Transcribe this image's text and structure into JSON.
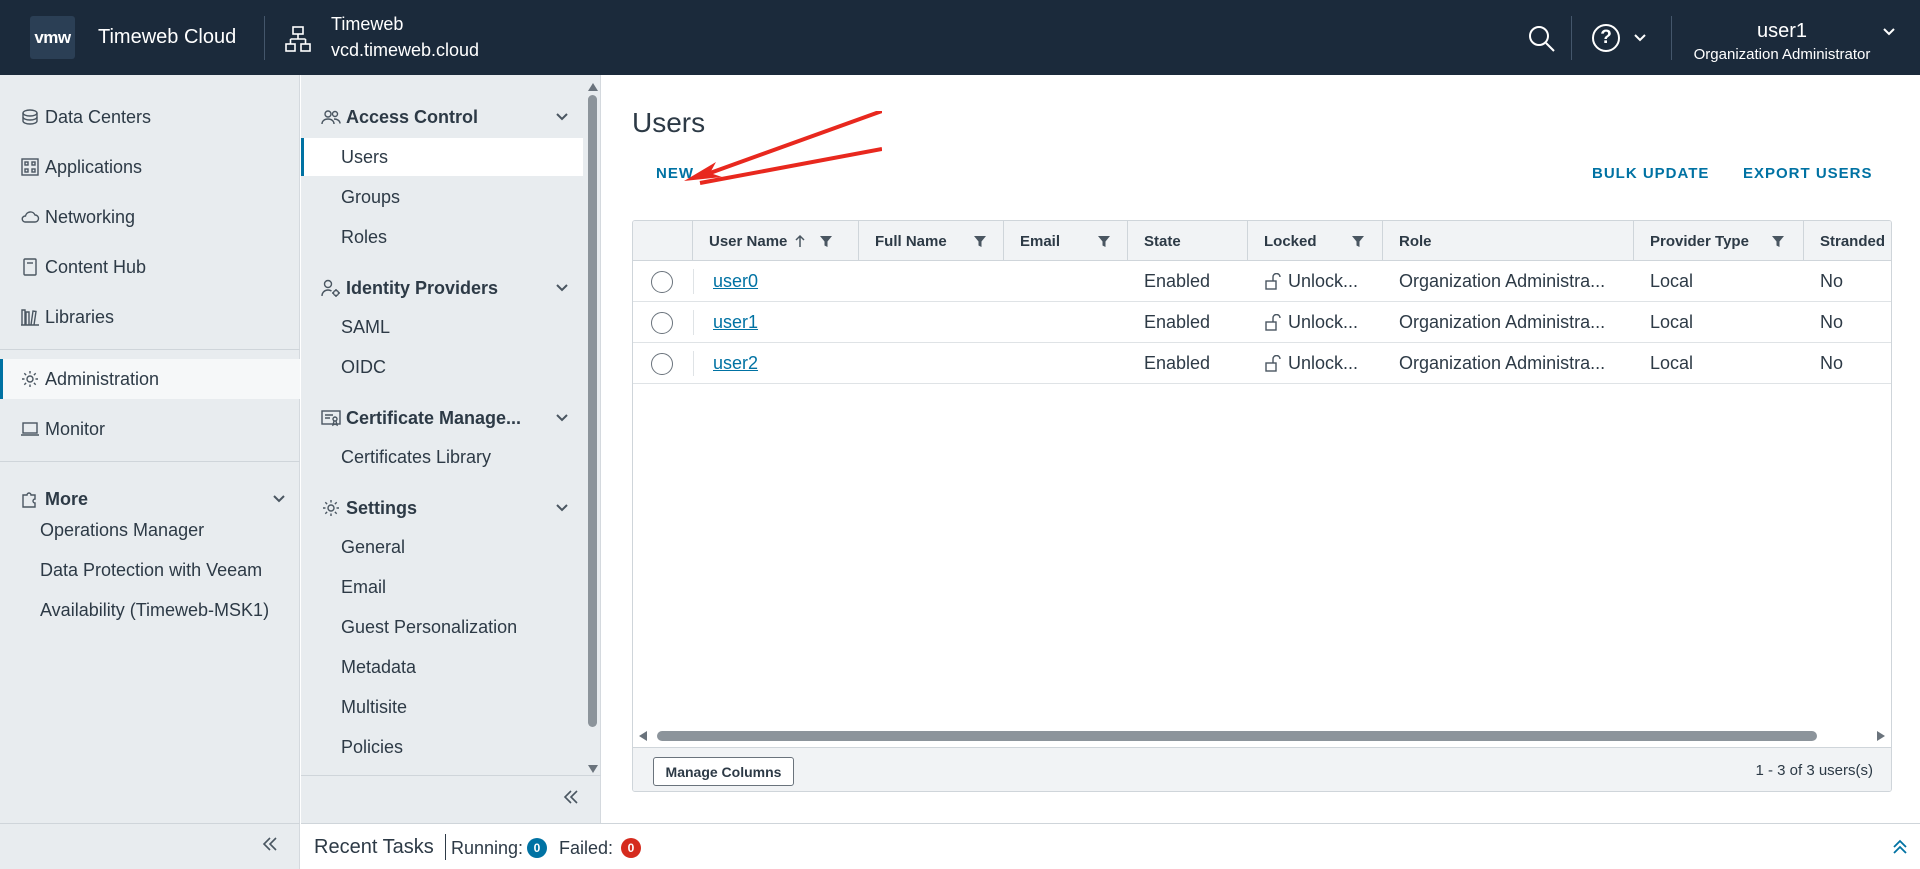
{
  "header": {
    "logo": "vmw",
    "app_name": "Timeweb Cloud",
    "org_name": "Timeweb",
    "org_url": "vcd.timeweb.cloud",
    "user_name": "user1",
    "user_role": "Organization Administrator",
    "help_glyph": "?"
  },
  "leftnav": {
    "items": [
      {
        "label": "Data Centers",
        "icon": "datacenter-icon"
      },
      {
        "label": "Applications",
        "icon": "applications-icon"
      },
      {
        "label": "Networking",
        "icon": "cloud-icon"
      },
      {
        "label": "Content Hub",
        "icon": "content-hub-icon"
      },
      {
        "label": "Libraries",
        "icon": "library-icon"
      },
      {
        "label": "Administration",
        "icon": "gear-icon",
        "active": true
      },
      {
        "label": "Monitor",
        "icon": "monitor-icon"
      }
    ],
    "more_label": "More",
    "more_items": [
      "Operations Manager",
      "Data Protection with Veeam",
      "Availability (Timeweb-MSK1)"
    ]
  },
  "subnav": {
    "sections": [
      {
        "title": "Access Control",
        "items": [
          "Users",
          "Groups",
          "Roles"
        ]
      },
      {
        "title": "Identity Providers",
        "items": [
          "SAML",
          "OIDC"
        ]
      },
      {
        "title": "Certificate Manage...",
        "items": [
          "Certificates Library"
        ]
      },
      {
        "title": "Settings",
        "items": [
          "General",
          "Email",
          "Guest Personalization",
          "Metadata",
          "Multisite",
          "Policies"
        ]
      }
    ]
  },
  "main": {
    "title": "Users",
    "new_label": "NEW",
    "bulk_update_label": "BULK UPDATE",
    "export_users_label": "EXPORT USERS",
    "columns": [
      "User Name",
      "Full Name",
      "Email",
      "State",
      "Locked",
      "Role",
      "Provider Type",
      "Stranded"
    ],
    "rows": [
      {
        "user_name": "user0",
        "full_name": "",
        "email": "",
        "state": "Enabled",
        "locked": "Unlock...",
        "role": "Organization Administra...",
        "provider_type": "Local",
        "stranded": "No"
      },
      {
        "user_name": "user1",
        "full_name": "",
        "email": "",
        "state": "Enabled",
        "locked": "Unlock...",
        "role": "Organization Administra...",
        "provider_type": "Local",
        "stranded": "No"
      },
      {
        "user_name": "user2",
        "full_name": "",
        "email": "",
        "state": "Enabled",
        "locked": "Unlock...",
        "role": "Organization Administra...",
        "provider_type": "Local",
        "stranded": "No"
      }
    ],
    "manage_columns_label": "Manage Columns",
    "pagination": "1 - 3 of 3 users(s)"
  },
  "taskbar": {
    "title": "Recent Tasks",
    "running_label": "Running:",
    "running_count": "0",
    "failed_label": "Failed:",
    "failed_count": "0"
  },
  "colors": {
    "header_bg": "#1b2a3b",
    "accent": "#0072a3",
    "arrow": "#e8281e",
    "running_badge": "#0072a3",
    "failed_badge": "#d52b1e"
  }
}
